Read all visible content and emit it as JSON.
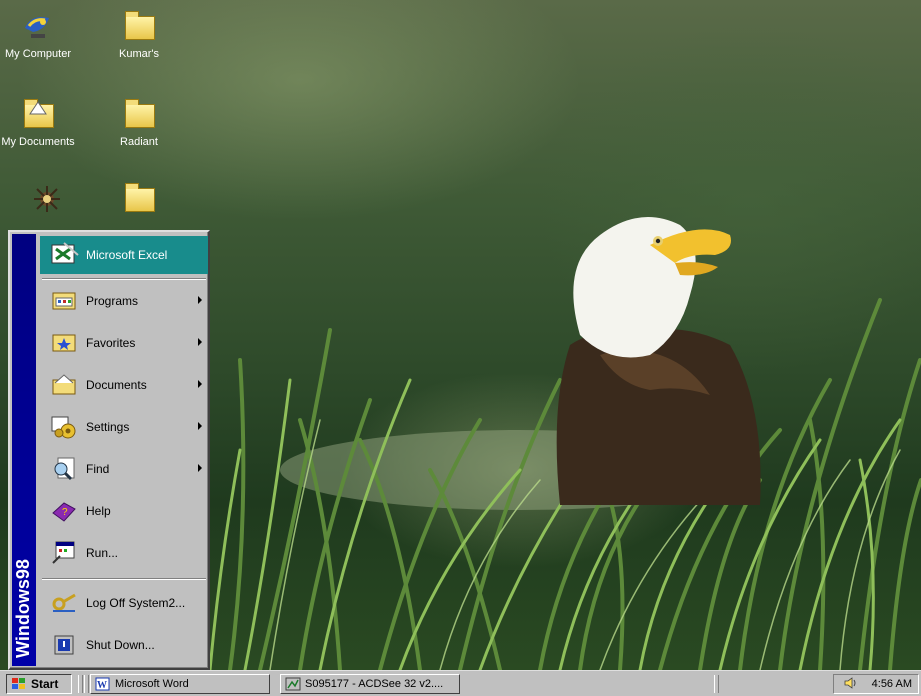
{
  "desktop_icons": [
    {
      "label": "My Computer",
      "icon": "my-computer-icon"
    },
    {
      "label": "Kumar's",
      "icon": "folder-icon"
    },
    {
      "label": "My Documents",
      "icon": "my-documents-icon"
    },
    {
      "label": "Radiant",
      "icon": "folder-icon"
    },
    {
      "label": "",
      "icon": "network-neighborhood-icon"
    },
    {
      "label": "",
      "icon": "folder-icon"
    }
  ],
  "start_menu": {
    "sidebar_text": "Windows98",
    "pinned": {
      "label": "Microsoft Excel",
      "icon": "excel-icon"
    },
    "items": [
      {
        "label": "Programs",
        "icon": "programs-icon",
        "submenu": true
      },
      {
        "label": "Favorites",
        "icon": "favorites-icon",
        "submenu": true
      },
      {
        "label": "Documents",
        "icon": "documents-icon",
        "submenu": true
      },
      {
        "label": "Settings",
        "icon": "settings-icon",
        "submenu": true
      },
      {
        "label": "Find",
        "icon": "find-icon",
        "submenu": true
      },
      {
        "label": "Help",
        "icon": "help-icon",
        "submenu": false
      },
      {
        "label": "Run...",
        "icon": "run-icon",
        "submenu": false
      }
    ],
    "footer": [
      {
        "label": "Log Off System2...",
        "icon": "log-off-icon"
      },
      {
        "label": "Shut Down...",
        "icon": "shut-down-icon"
      }
    ]
  },
  "taskbar": {
    "start_label": "Start",
    "tasks": [
      {
        "label": "Microsoft Word",
        "icon": "word-icon"
      },
      {
        "label": "S095177 - ACDSee 32 v2....",
        "icon": "acdsee-icon"
      }
    ],
    "tray": {
      "time": "4:56 AM",
      "icon": "speaker-icon"
    }
  },
  "colors": {
    "menu_sidebar": "#000080",
    "menu_highlight": "#188c8c",
    "chrome": "#c0c0c0"
  }
}
